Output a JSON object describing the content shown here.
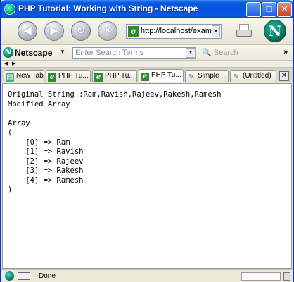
{
  "window": {
    "title": "PHP Tutorial: Working with String - Netscape",
    "min_glyph": "_",
    "max_glyph": "□",
    "close_glyph": "✕"
  },
  "navbar": {
    "back_icon": "back-arrow-icon",
    "forward_icon": "forward-arrow-icon",
    "reload_icon": "reload-icon",
    "stop_icon": "stop-icon",
    "back_glyph": "◀",
    "forward_glyph": "▶",
    "reload_glyph": "↻",
    "stop_glyph": "✕",
    "url": "http://localhost/example",
    "url_icon_glyph": "e",
    "drop_glyph": "▼",
    "logo_glyph": "N"
  },
  "searchbar": {
    "brand": "Netscape",
    "brand_caret": "▼",
    "placeholder": "Enter Search Terms",
    "search_label": "Search",
    "more_glyph": "»",
    "mag_glyph": "🔍"
  },
  "minibar": {
    "left_glyph": "◀",
    "right_glyph": "▶"
  },
  "tabs": [
    {
      "label": "New Tab",
      "icon": "n"
    },
    {
      "label": "PHP Tu...",
      "icon": "e"
    },
    {
      "label": "PHP Tu...",
      "icon": "e"
    },
    {
      "label": "PHP Tu...",
      "icon": "e"
    },
    {
      "label": "Simple ...",
      "icon": "w"
    },
    {
      "label": "(Untitled)",
      "icon": "w"
    }
  ],
  "tab_close_glyph": "✕",
  "content": {
    "lines": [
      "Original String :Ram,Ravish,Rajeev,Rakesh,Ramesh",
      "Modified Array",
      "",
      "Array",
      "(",
      "    [0] => Ram",
      "    [1] => Ravish",
      "    [2] => Rajeev",
      "    [3] => Rakesh",
      "    [4] => Ramesh",
      ")"
    ]
  },
  "status": {
    "text": "Done"
  }
}
